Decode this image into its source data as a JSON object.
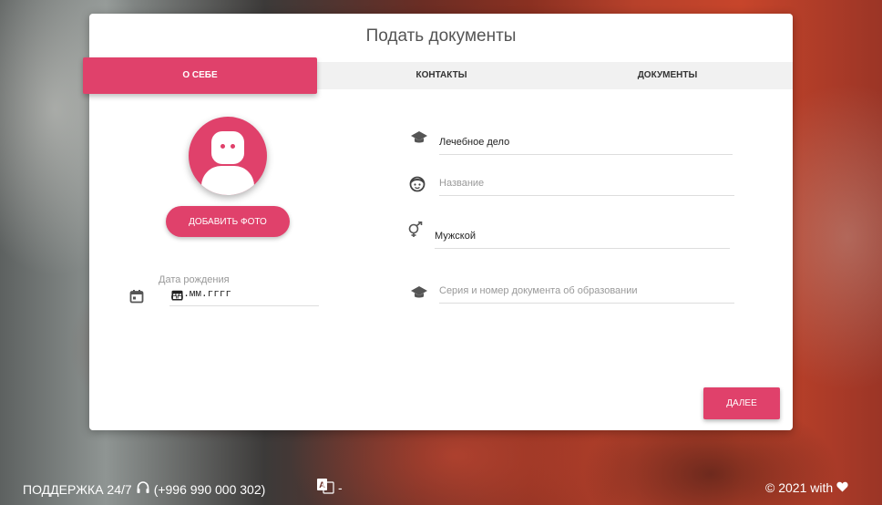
{
  "card": {
    "title": "Подать документы"
  },
  "tabs": [
    {
      "label": "О СЕБЕ",
      "active": true
    },
    {
      "label": "КОНТАКТЫ",
      "active": false
    },
    {
      "label": "ДОКУМЕНТЫ",
      "active": false
    }
  ],
  "photo": {
    "add_button": "ДОБАВИТЬ ФОТО"
  },
  "birth_date": {
    "label": "Дата рождения",
    "placeholder": "дд.мм.гггг"
  },
  "fields": {
    "specialty": {
      "value": "Лечебное дело",
      "icon": "graduation-cap-icon"
    },
    "name": {
      "placeholder": "Название",
      "icon": "face-icon"
    },
    "gender": {
      "value": "Мужской",
      "icon": "gender-icon"
    },
    "education_doc": {
      "placeholder": "Серия и номер документа об образовании",
      "icon": "graduation-cap-icon"
    }
  },
  "next_button": "ДАЛЕЕ",
  "footer": {
    "support_label": "ПОДДЕРЖКА 24/7",
    "phone": "(+996 990 000 302)",
    "lang_separator": "-",
    "copyright": "© 2021 with"
  },
  "colors": {
    "accent": "#e0416b",
    "tab_bar": "#f1f1f1"
  }
}
